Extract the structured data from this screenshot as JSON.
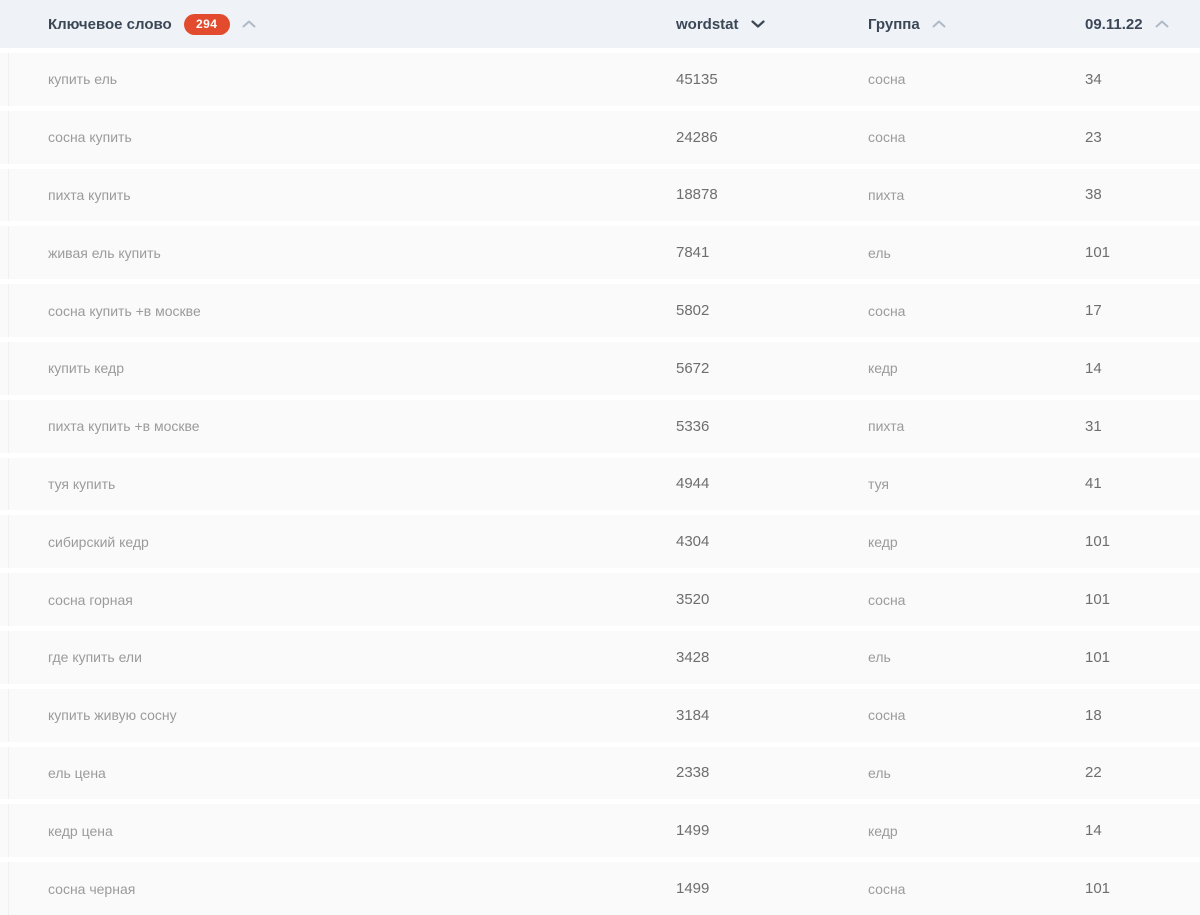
{
  "table": {
    "header": {
      "keyword": {
        "label": "Ключевое слово",
        "badge": "294",
        "sort_dir": "asc",
        "sort_active": false
      },
      "wordstat": {
        "label": "wordstat",
        "sort_dir": "desc",
        "sort_active": true
      },
      "group": {
        "label": "Группа",
        "sort_dir": "asc",
        "sort_active": false
      },
      "date": {
        "label": "09.11.22",
        "sort_dir": "asc",
        "sort_active": false
      }
    },
    "rows": [
      {
        "keyword": "купить ель",
        "wordstat": "45135",
        "group": "сосна",
        "date_value": "34"
      },
      {
        "keyword": "сосна купить",
        "wordstat": "24286",
        "group": "сосна",
        "date_value": "23"
      },
      {
        "keyword": "пихта купить",
        "wordstat": "18878",
        "group": "пихта",
        "date_value": "38"
      },
      {
        "keyword": "живая ель купить",
        "wordstat": "7841",
        "group": "ель",
        "date_value": "101"
      },
      {
        "keyword": "сосна купить +в москве",
        "wordstat": "5802",
        "group": "сосна",
        "date_value": "17"
      },
      {
        "keyword": "купить кедр",
        "wordstat": "5672",
        "group": "кедр",
        "date_value": "14"
      },
      {
        "keyword": "пихта купить +в москве",
        "wordstat": "5336",
        "group": "пихта",
        "date_value": "31"
      },
      {
        "keyword": "туя купить",
        "wordstat": "4944",
        "group": "туя",
        "date_value": "41"
      },
      {
        "keyword": "сибирский кедр",
        "wordstat": "4304",
        "group": "кедр",
        "date_value": "101"
      },
      {
        "keyword": "сосна горная",
        "wordstat": "3520",
        "group": "сосна",
        "date_value": "101"
      },
      {
        "keyword": "где купить ели",
        "wordstat": "3428",
        "group": "ель",
        "date_value": "101"
      },
      {
        "keyword": "купить живую сосну",
        "wordstat": "3184",
        "group": "сосна",
        "date_value": "18"
      },
      {
        "keyword": "ель цена",
        "wordstat": "2338",
        "group": "ель",
        "date_value": "22"
      },
      {
        "keyword": "кедр цена",
        "wordstat": "1499",
        "group": "кедр",
        "date_value": "14"
      },
      {
        "keyword": "сосна черная",
        "wordstat": "1499",
        "group": "сосна",
        "date_value": "101"
      }
    ]
  },
  "colors": {
    "badge_bg": "#e24b2d",
    "badge_text": "#ffffff",
    "header_bg": "#eff3f8",
    "header_text": "#3c4756",
    "active_sort_icon": "#3c4756",
    "inactive_sort_icon": "#aebac6",
    "row_bg": "#fafafa",
    "keyword_text": "#9b9b9b",
    "number_text": "#6e6e6e"
  }
}
